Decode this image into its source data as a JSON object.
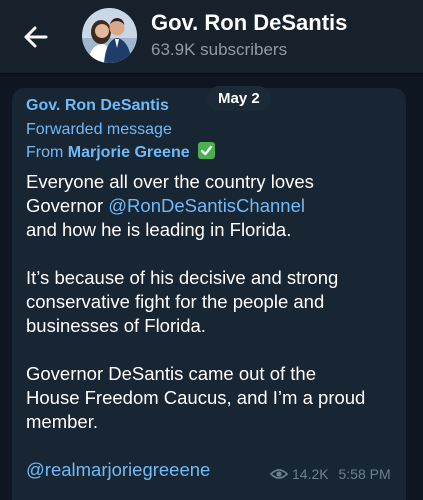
{
  "header": {
    "title": "Gov. Ron DeSantis",
    "subscribers": "63.9K subscribers"
  },
  "date_pill": "May 2",
  "message": {
    "sender": "Gov. Ron DeSantis",
    "forwarded_label": "Forwarded message",
    "from_prefix": "From",
    "from_name": "Marjorie Greene",
    "lines": [
      "Everyone all over the country loves",
      "Governor ",
      "@RonDeSantisChannel",
      " and how he is leading in Florida.",
      "It’s because of his decisive and strong",
      "conservative fight for the people and",
      "businesses of Florida.",
      "Governor DeSantis came out of the",
      "House Freedom Caucus, and I’m a proud",
      "member.",
      "@realmarjoriegreeene"
    ],
    "views": "14.2K",
    "time": "5:58 PM"
  },
  "icons": {
    "back": "arrow-left-icon",
    "verified": "check-mark-icon",
    "views": "eye-icon"
  },
  "colors": {
    "background": "#0e1621",
    "header": "#17212b",
    "bubble": "#182533",
    "link": "#71baf7",
    "verified": "#4caf50"
  }
}
